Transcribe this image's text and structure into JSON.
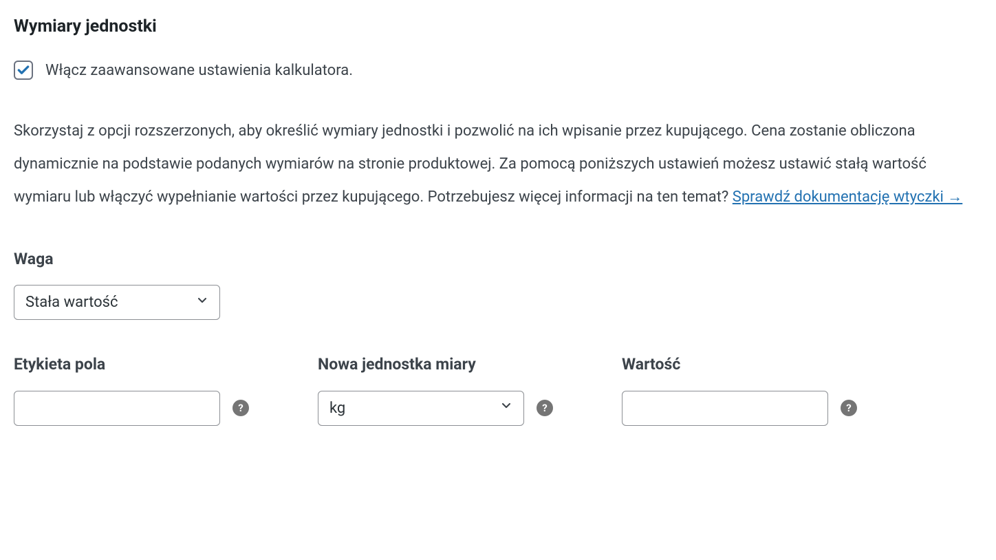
{
  "section": {
    "title": "Wymiary jednostki"
  },
  "checkbox": {
    "label": "Włącz zaawansowane ustawienia kalkulatora.",
    "checked": true
  },
  "description": {
    "text": "Skorzystaj z opcji rozszerzonych, aby określić wymiary jednostki i pozwolić na ich wpisanie przez kupującego. Cena zostanie obliczona dynamicznie na podstawie podanych wymiarów na stronie produktowej. Za pomocą poniższych ustawień możesz ustawić stałą wartość wymiaru lub włączyć wypełnianie wartości przez kupującego. Potrzebujesz więcej informacji na ten temat? ",
    "link_text": "Sprawdź dokumentację wtyczki →"
  },
  "weight": {
    "title": "Waga",
    "select_value": "Stała wartość"
  },
  "fields": {
    "label_field": {
      "label": "Etykieta pola",
      "value": ""
    },
    "unit_field": {
      "label": "Nowa jednostka miary",
      "selected": "kg"
    },
    "value_field": {
      "label": "Wartość",
      "value": ""
    }
  }
}
